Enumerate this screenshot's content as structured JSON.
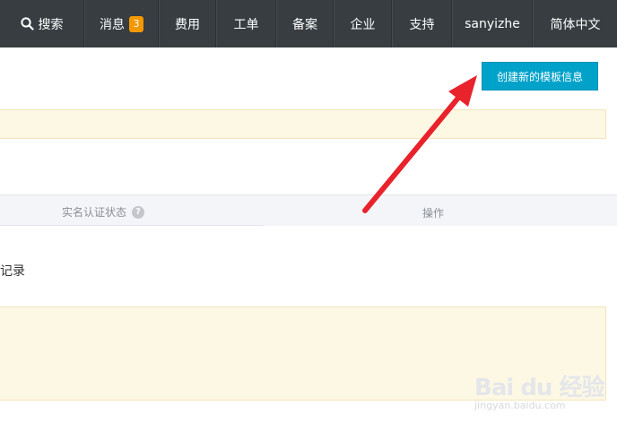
{
  "topnav": {
    "items": [
      {
        "label": "搜索",
        "icon": "search-icon"
      },
      {
        "label": "消息",
        "badge": "3"
      },
      {
        "label": "费用"
      },
      {
        "label": "工单"
      },
      {
        "label": "备案"
      },
      {
        "label": "企业"
      },
      {
        "label": "支持"
      },
      {
        "label": "sanyizhe"
      },
      {
        "label": "简体中文"
      }
    ]
  },
  "actions": {
    "create_label": "创建新的模板信息"
  },
  "table": {
    "columns": [
      "实名认证状态",
      "操作"
    ],
    "empty_text_fragment": "记录"
  },
  "watermark": {
    "logo": "Bai du 经验",
    "url": "jingyan.baidu.com"
  },
  "colors": {
    "nav_bg": "#373d41",
    "badge": "#f39800",
    "primary_button": "#00a2ca",
    "notice_bg": "#fdf8e4",
    "annotation_arrow": "#e8232c"
  }
}
